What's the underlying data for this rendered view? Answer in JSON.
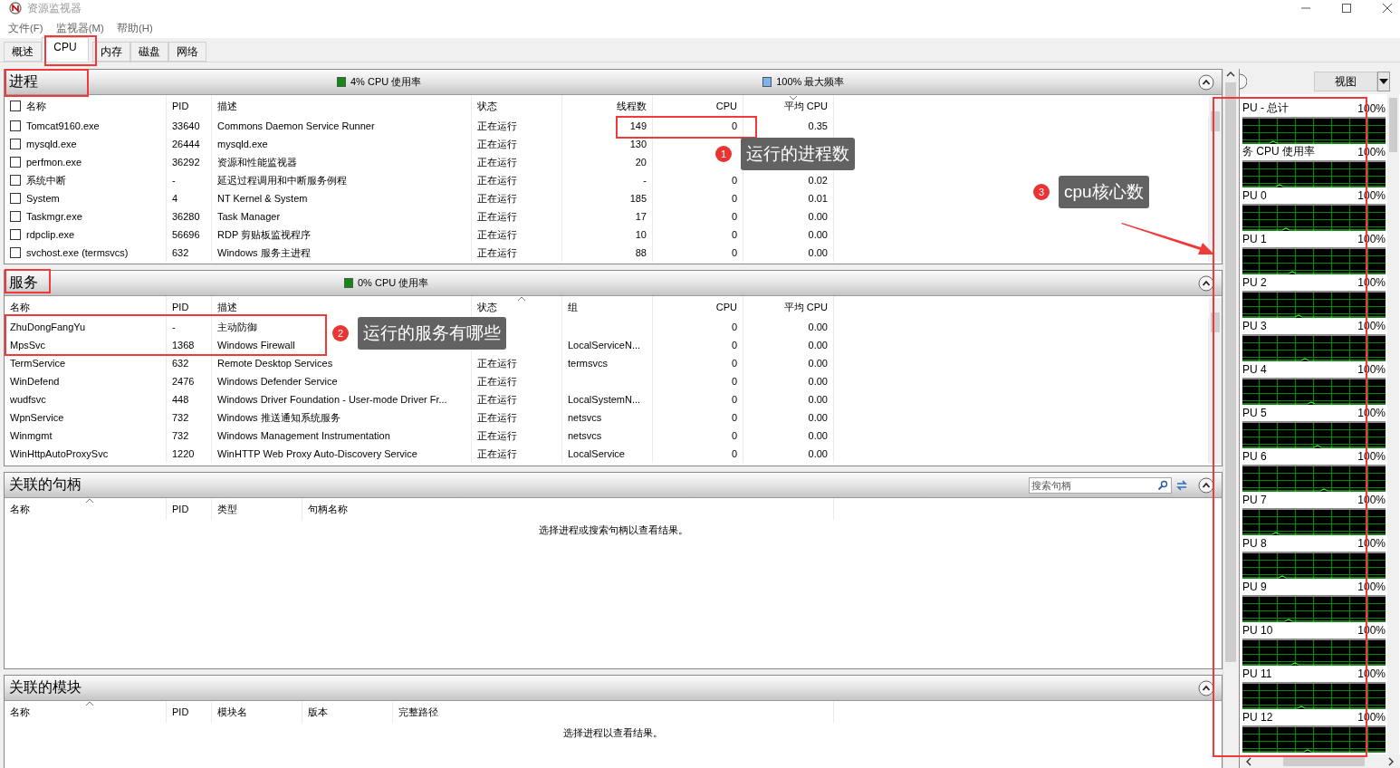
{
  "window": {
    "title": "资源监视器"
  },
  "menu": [
    "文件(F)",
    "监视器(M)",
    "帮助(H)"
  ],
  "tabs": [
    {
      "label": "概述",
      "selected": false
    },
    {
      "label": "CPU",
      "selected": true
    },
    {
      "label": "内存",
      "selected": false
    },
    {
      "label": "磁盘",
      "selected": false
    },
    {
      "label": "网络",
      "selected": false
    }
  ],
  "panels": [
    {
      "kind": "processes",
      "title": "进程",
      "select_all_checked": false,
      "legend": [
        {
          "text": "4% CPU 使用率",
          "color": "#138a13"
        },
        {
          "text": "100% 最大频率",
          "color": "#7cb3f2"
        }
      ],
      "columns": [
        {
          "label": "名称",
          "sorted": false
        },
        {
          "label": "PID",
          "sorted": false
        },
        {
          "label": "描述",
          "sorted": false
        },
        {
          "label": "状态",
          "sorted": false
        },
        {
          "label": "线程数",
          "sorted": false
        },
        {
          "label": "CPU",
          "sorted": false
        },
        {
          "label": "平均 CPU",
          "sorted": true,
          "descending": true
        }
      ],
      "rows": [
        {
          "checked": false,
          "cells": [
            "Tomcat9160.exe",
            "33640",
            "Commons Daemon Service Runner",
            "正在运行",
            "149",
            "0",
            "0.35"
          ]
        },
        {
          "checked": false,
          "cells": [
            "mysqld.exe",
            "26444",
            "mysqld.exe",
            "正在运行",
            "130",
            null,
            null
          ]
        },
        {
          "checked": false,
          "cells": [
            "perfmon.exe",
            "36292",
            "资源和性能监视器",
            "正在运行",
            "20",
            null,
            null
          ]
        },
        {
          "checked": false,
          "cells": [
            "系统中断",
            "-",
            "延迟过程调用和中断服务例程",
            "正在运行",
            "-",
            "0",
            "0.02"
          ]
        },
        {
          "checked": false,
          "cells": [
            "System",
            "4",
            "NT Kernel & System",
            "正在运行",
            "185",
            "0",
            "0.01"
          ]
        },
        {
          "checked": false,
          "cells": [
            "Taskmgr.exe",
            "36280",
            "Task Manager",
            "正在运行",
            "17",
            "0",
            "0.00"
          ]
        },
        {
          "checked": false,
          "cells": [
            "rdpclip.exe",
            "56696",
            "RDP 剪贴板监视程序",
            "正在运行",
            "10",
            "0",
            "0.00"
          ]
        },
        {
          "checked": false,
          "cells": [
            "svchost.exe (termsvcs)",
            "632",
            "Windows 服务主进程",
            "正在运行",
            "88",
            "0",
            "0.00"
          ]
        }
      ]
    },
    {
      "kind": "services",
      "title": "服务",
      "legend": [
        {
          "text": "0% CPU 使用率",
          "color": "#138a13"
        }
      ],
      "columns": [
        {
          "label": "名称",
          "sorted": false
        },
        {
          "label": "PID",
          "sorted": false
        },
        {
          "label": "描述",
          "sorted": false
        },
        {
          "label": "状态",
          "sorted": true,
          "descending": false
        },
        {
          "label": "组",
          "sorted": false
        },
        {
          "label": "CPU",
          "sorted": false
        },
        {
          "label": "平均 CPU",
          "sorted": false
        }
      ],
      "rows": [
        {
          "cells": [
            "ZhuDongFangYu",
            "-",
            "主动防御",
            null,
            null,
            "0",
            "0.00"
          ]
        },
        {
          "cells": [
            "MpsSvc",
            "1368",
            "Windows Firewall",
            null,
            "LocalServiceN...",
            "0",
            "0.00"
          ]
        },
        {
          "cells": [
            "TermService",
            "632",
            "Remote Desktop Services",
            "正在运行",
            "termsvcs",
            "0",
            "0.00"
          ]
        },
        {
          "cells": [
            "WinDefend",
            "2476",
            "Windows Defender Service",
            "正在运行",
            null,
            "0",
            "0.00"
          ]
        },
        {
          "cells": [
            "wudfsvc",
            "448",
            "Windows Driver Foundation - User-mode Driver Fr...",
            "正在运行",
            "LocalSystemN...",
            "0",
            "0.00"
          ]
        },
        {
          "cells": [
            "WpnService",
            "732",
            "Windows 推送通知系统服务",
            "正在运行",
            "netsvcs",
            "0",
            "0.00"
          ]
        },
        {
          "cells": [
            "Winmgmt",
            "732",
            "Windows Management Instrumentation",
            "正在运行",
            "netsvcs",
            "0",
            "0.00"
          ]
        },
        {
          "cells": [
            "WinHttpAutoProxySvc",
            "1220",
            "WinHTTP Web Proxy Auto-Discovery Service",
            "正在运行",
            "LocalService",
            "0",
            "0.00"
          ]
        }
      ]
    },
    {
      "kind": "handles",
      "title": "关联的句柄",
      "search": {
        "placeholder": "搜索句柄"
      },
      "columns": [
        {
          "label": "名称",
          "sorted": true,
          "descending": false
        },
        {
          "label": "PID",
          "sorted": false
        },
        {
          "label": "类型",
          "sorted": false
        },
        {
          "label": "句柄名称",
          "sorted": false
        }
      ],
      "message": "选择进程或搜索句柄以查看结果。"
    },
    {
      "kind": "modules",
      "title": "关联的模块",
      "columns": [
        {
          "label": "名称",
          "sorted": true,
          "descending": false
        },
        {
          "label": "PID",
          "sorted": false
        },
        {
          "label": "模块名",
          "sorted": false
        },
        {
          "label": "版本",
          "sorted": false
        },
        {
          "label": "完整路径",
          "sorted": false
        }
      ],
      "message": "选择进程以查看结果。"
    }
  ],
  "side_panel": {
    "view_button": "视图",
    "graphs": [
      {
        "label": "PU - 总计",
        "value": "100%"
      },
      {
        "label": "务 CPU 使用率",
        "value": "100%"
      },
      {
        "label": "PU 0",
        "value": "100%"
      },
      {
        "label": "PU 1",
        "value": "100%"
      },
      {
        "label": "PU 2",
        "value": "100%"
      },
      {
        "label": "PU 3",
        "value": "100%"
      },
      {
        "label": "PU 4",
        "value": "100%"
      },
      {
        "label": "PU 5",
        "value": "100%"
      },
      {
        "label": "PU 6",
        "value": "100%"
      },
      {
        "label": "PU 7",
        "value": "100%"
      },
      {
        "label": "PU 8",
        "value": "100%"
      },
      {
        "label": "PU 9",
        "value": "100%"
      },
      {
        "label": "PU 10",
        "value": "100%"
      },
      {
        "label": "PU 11",
        "value": "100%"
      },
      {
        "label": "PU 12",
        "value": "100%"
      }
    ]
  },
  "annotations": [
    {
      "number": "1",
      "text": "运行的进程数"
    },
    {
      "number": "2",
      "text": "运行的服务有哪些"
    },
    {
      "number": "3",
      "text": "cpu核心数"
    }
  ]
}
